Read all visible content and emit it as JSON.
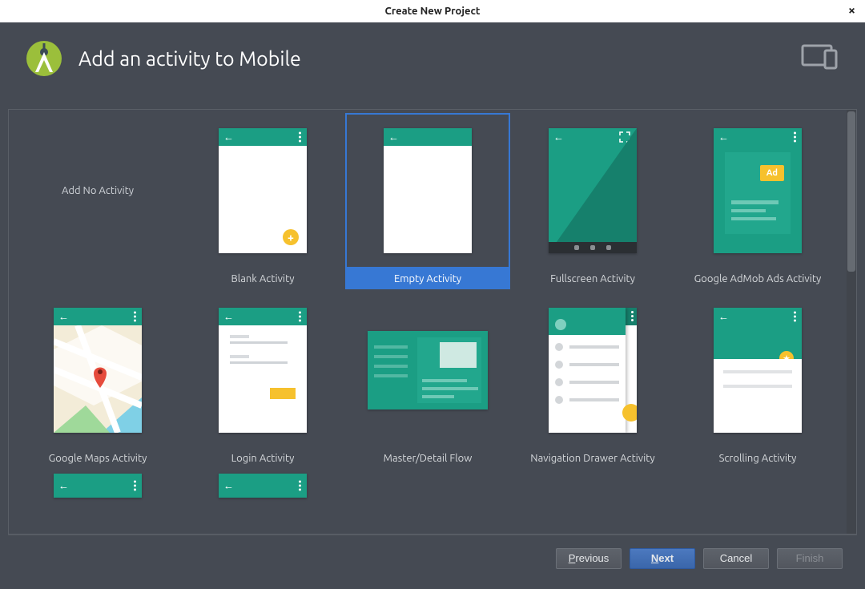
{
  "window": {
    "title": "Create New Project"
  },
  "header": {
    "title": "Add an activity to Mobile"
  },
  "templates": [
    {
      "id": "none",
      "label": "Add No Activity",
      "kind": "none",
      "selected": false
    },
    {
      "id": "blank",
      "label": "Blank Activity",
      "kind": "blank",
      "selected": false
    },
    {
      "id": "empty",
      "label": "Empty Activity",
      "kind": "empty",
      "selected": true
    },
    {
      "id": "fullscreen",
      "label": "Fullscreen Activity",
      "kind": "fullscreen",
      "selected": false
    },
    {
      "id": "admob",
      "label": "Google AdMob Ads Activity",
      "kind": "admob",
      "selected": false,
      "ad_text": "Ad"
    },
    {
      "id": "maps",
      "label": "Google Maps Activity",
      "kind": "maps",
      "selected": false
    },
    {
      "id": "login",
      "label": "Login Activity",
      "kind": "login",
      "selected": false
    },
    {
      "id": "master",
      "label": "Master/Detail Flow",
      "kind": "master",
      "selected": false
    },
    {
      "id": "drawer",
      "label": "Navigation Drawer Activity",
      "kind": "drawer",
      "selected": false
    },
    {
      "id": "scrolling",
      "label": "Scrolling Activity",
      "kind": "scrolling",
      "selected": false
    },
    {
      "id": "partial1",
      "label": "",
      "kind": "partial",
      "selected": false
    },
    {
      "id": "partial2",
      "label": "",
      "kind": "partial",
      "selected": false
    }
  ],
  "footer": {
    "previous": "Previous",
    "next": "Next",
    "cancel": "Cancel",
    "finish": "Finish"
  },
  "colors": {
    "panel_bg": "#454a53",
    "selection": "#3778d4",
    "teal": "#1b9e84",
    "accent_amber": "#f6c12d"
  }
}
